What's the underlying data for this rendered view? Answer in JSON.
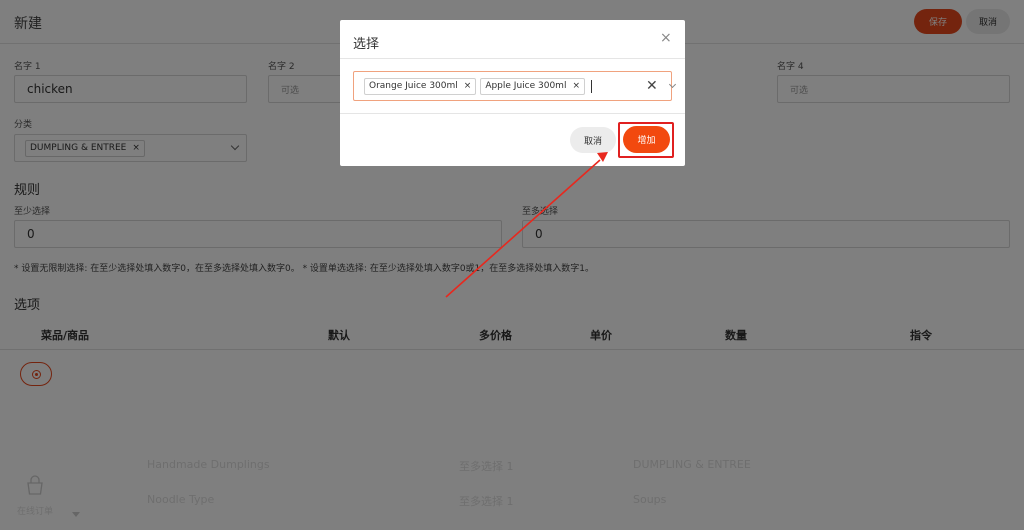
{
  "page": {
    "title": "新建",
    "save_label": "保存",
    "cancel_label": "取消"
  },
  "names": [
    {
      "label": "名字 1",
      "value": "chicken"
    },
    {
      "label": "名字 2",
      "placeholder": "可选"
    },
    {
      "label": "名字 4",
      "placeholder": "可选"
    }
  ],
  "category": {
    "label": "分类",
    "chip": "DUMPLING & ENTREE",
    "chip_remove": "×"
  },
  "rules": {
    "heading": "规则",
    "min_label": "至少选择",
    "min_value": "0",
    "max_label": "至多选择",
    "max_value": "0",
    "note": "* 设置无限制选择: 在至少选择处填入数字0，在至多选择处填入数字0。 * 设置单选选择: 在至少选择处填入数字0或1，在至多选择处填入数字1。"
  },
  "options": {
    "heading": "选项",
    "columns": [
      "菜品/商品",
      "默认",
      "多价格",
      "单价",
      "数量",
      "指令"
    ]
  },
  "background_list": {
    "side_label": "在线订单",
    "rows": [
      {
        "name": "Handmade Dumplings",
        "rule": "至多选择 1",
        "category": "DUMPLING & ENTREE"
      },
      {
        "name": "Noodle Type",
        "rule": "至多选择 1",
        "category": "Soups"
      }
    ]
  },
  "modal": {
    "title": "选择",
    "close": "×",
    "selected": [
      {
        "label": "Orange Juice 300ml",
        "remove": "×"
      },
      {
        "label": "Apple Juice 300ml",
        "remove": "×"
      }
    ],
    "clear": "✕",
    "cancel_label": "取消",
    "add_label": "增加"
  },
  "colors": {
    "accent": "#e9481d",
    "highlight": "#e02020"
  }
}
